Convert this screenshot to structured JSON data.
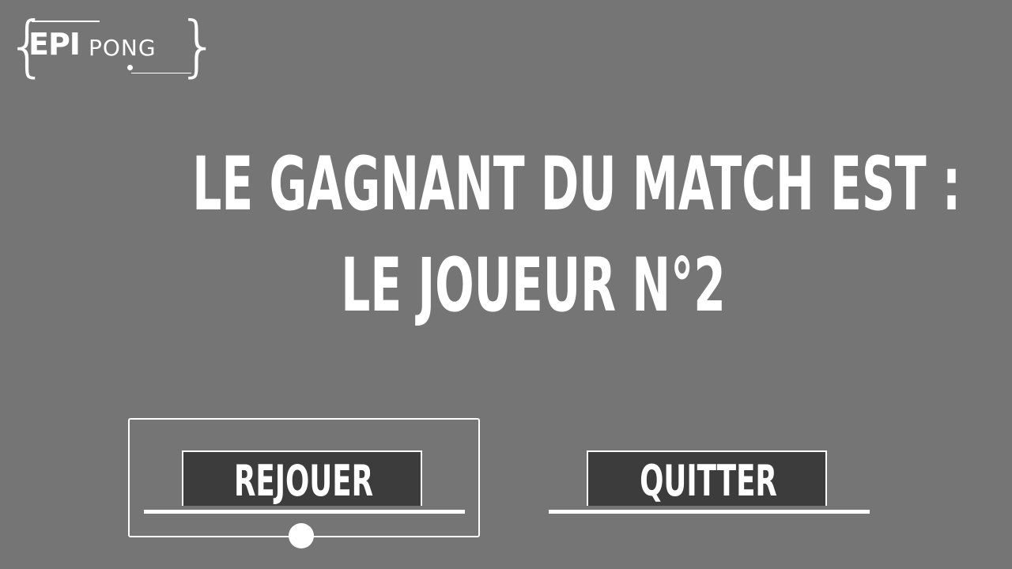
{
  "logo": {
    "text_bold": "EPI",
    "text_light": "PONG"
  },
  "result": {
    "line1": "LE GAGNANT DU MATCH EST :",
    "line2": "LE JOUEUR N°2"
  },
  "menu": {
    "replay_label": "REJOUER",
    "quit_label": "QUITTER",
    "selected": "REJOUER"
  },
  "colors": {
    "background": "#757575",
    "button_fill": "#3c3c3c",
    "foreground": "#ffffff"
  }
}
